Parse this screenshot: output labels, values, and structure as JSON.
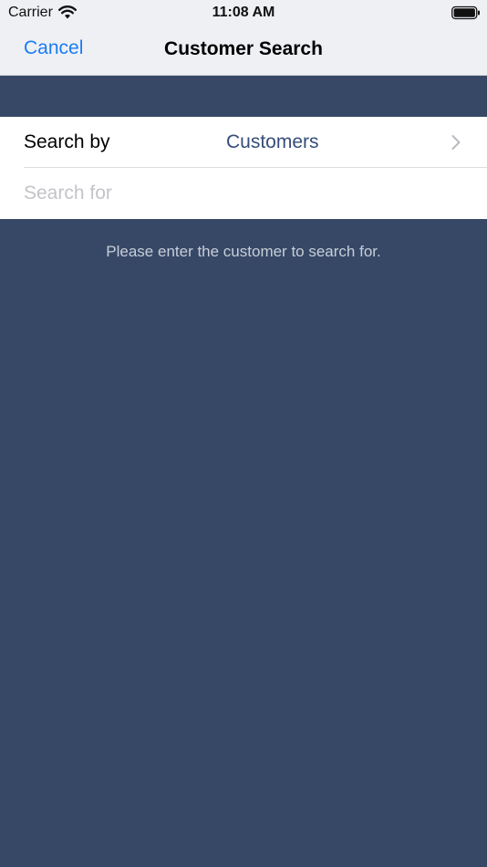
{
  "status_bar": {
    "carrier": "Carrier",
    "time": "11:08 AM"
  },
  "nav": {
    "cancel_label": "Cancel",
    "title": "Customer Search"
  },
  "form": {
    "search_by_label": "Search by",
    "search_by_value": "Customers",
    "search_for_placeholder": "Search for",
    "search_for_value": ""
  },
  "hint": "Please enter the customer to search for.",
  "colors": {
    "background": "#364866",
    "accent": "#1a7cf5",
    "value_text": "#364d79"
  },
  "icons": [
    "wifi-icon",
    "battery-icon",
    "chevron-right-icon"
  ]
}
